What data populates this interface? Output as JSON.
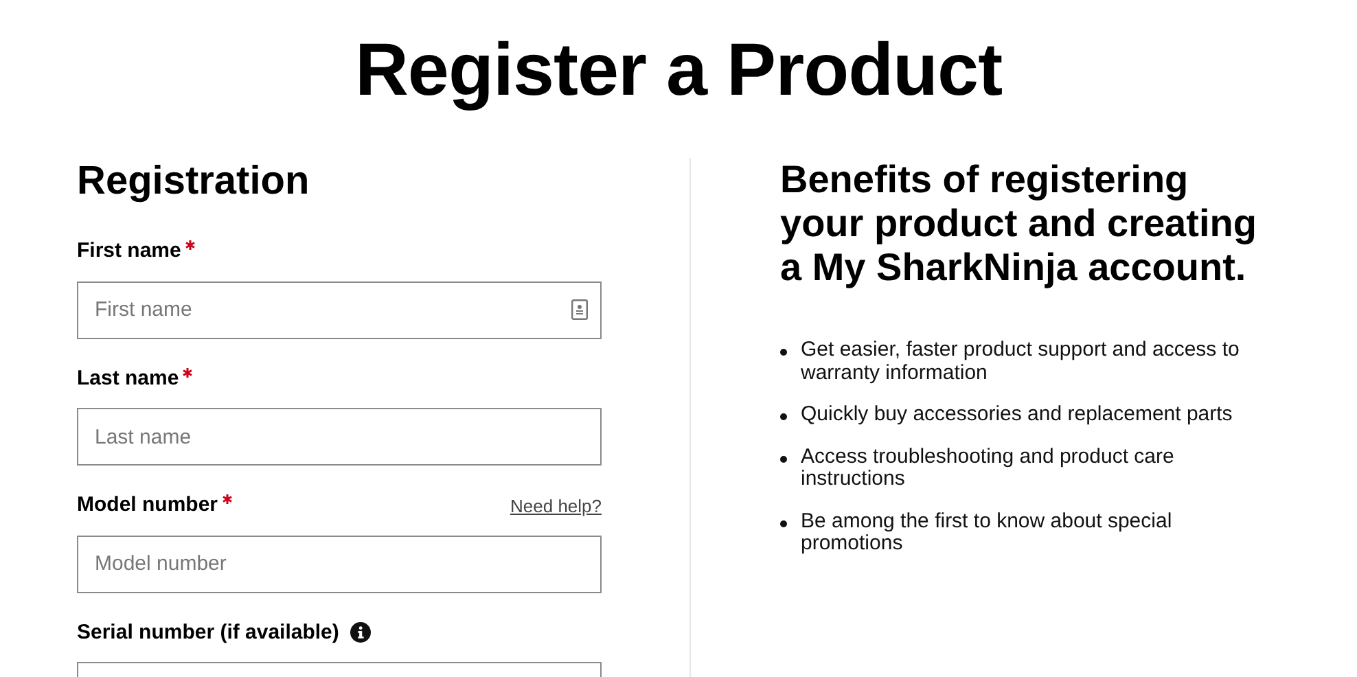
{
  "page_title": "Register a Product",
  "registration": {
    "heading": "Registration",
    "fields": [
      {
        "label": "First name",
        "required": true,
        "placeholder": "First name",
        "autofill_icon": true
      },
      {
        "label": "Last name",
        "required": true,
        "placeholder": "Last name"
      },
      {
        "label": "Model number",
        "required": true,
        "placeholder": "Model number",
        "help_link": "Need help?"
      },
      {
        "label": "Serial number (if available)",
        "required": false,
        "info_icon": true
      }
    ]
  },
  "benefits": {
    "heading": "Benefits of registering your product and creating a My SharkNinja account.",
    "items": [
      "Get easier, faster product support and access to warranty information",
      "Quickly buy accessories and replacement parts",
      "Access troubleshooting and product care instructions",
      "Be among the first to know about special promotions"
    ]
  }
}
